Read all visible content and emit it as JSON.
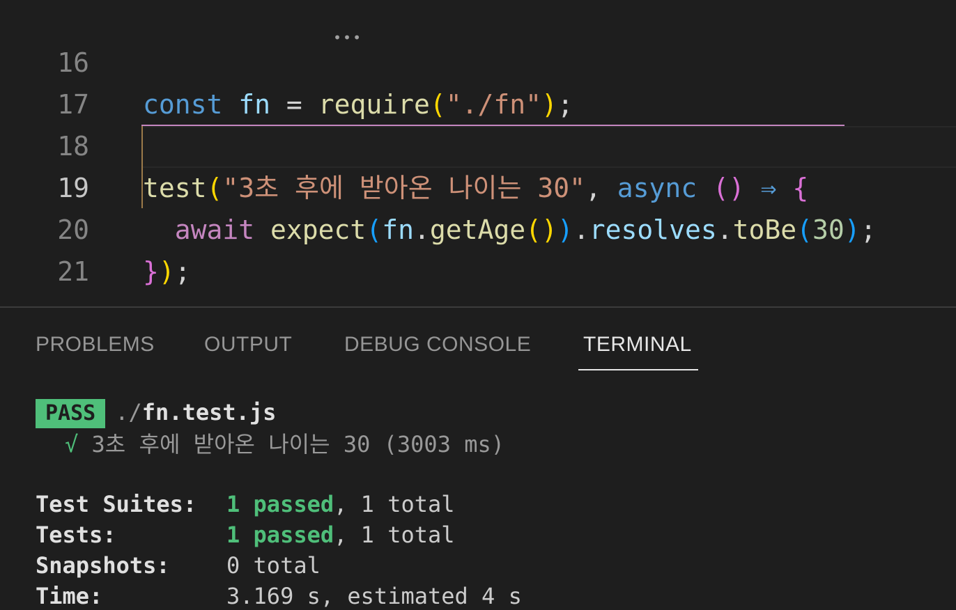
{
  "editor": {
    "lines": [
      {
        "number": "16",
        "t1": "const",
        "t2": " ",
        "t3": "fn",
        "t4": " = ",
        "t5": "require",
        "t6": "(",
        "t7": "\"./fn\"",
        "t8": ")",
        "t9": ";"
      },
      {
        "number": "17"
      },
      {
        "number": "18",
        "t1": "test",
        "t2": "(",
        "t3": "\"3초 후에 받아온 나이는 30\"",
        "t4": ", ",
        "t5": "async",
        "t6": " ",
        "t7": "()",
        "t8": " ⇒ ",
        "t9": "{"
      },
      {
        "number": "19",
        "t1": "  ",
        "t2": "await",
        "t3": " ",
        "t4": "expect",
        "t5": "(",
        "t6": "fn",
        "t7": ".",
        "t8": "getAge",
        "t9": "()",
        "t10": ")",
        "t11": ".",
        "t12": "resolves",
        "t13": ".",
        "t14": "toBe",
        "t15": "(",
        "t16": "30",
        "t17": ")",
        "t18": ";"
      },
      {
        "number": "20",
        "t1": "}",
        "t2": ")",
        "t3": ";"
      },
      {
        "number": "21"
      }
    ],
    "squiggle": "•••"
  },
  "panel": {
    "tabs": [
      "PROBLEMS",
      "OUTPUT",
      "DEBUG CONSOLE",
      "TERMINAL"
    ],
    "active_tab": "TERMINAL"
  },
  "terminal": {
    "pass_badge": "PASS",
    "file_dir": "./",
    "file_name": "fn.test.js",
    "test_check": "√",
    "test_name": "3초 후에 받아온 나이는 30",
    "test_duration": "(3003 ms)",
    "summary": {
      "suites_label": "Test Suites:",
      "suites_passed": "1 passed",
      "suites_total": ", 1 total",
      "tests_label": "Tests:",
      "tests_passed": "1 passed",
      "tests_total": ", 1 total",
      "snapshots_label": "Snapshots:",
      "snapshots_value": "0 total",
      "time_label": "Time:",
      "time_value": "3.169 s, estimated 4 s"
    }
  },
  "colors": {
    "pass_green": "#4fbf7a",
    "background": "#1e1e1e"
  }
}
